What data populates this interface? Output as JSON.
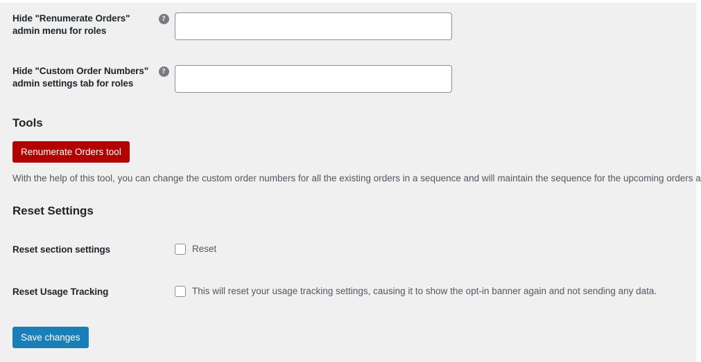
{
  "fields": [
    {
      "label": "Hide \"Renumerate Orders\" admin menu for roles",
      "help_icon": "question-mark-circle-icon",
      "value": "",
      "placeholder": ""
    },
    {
      "label": "Hide \"Custom Order Numbers\" admin settings tab for roles",
      "help_icon": "question-mark-circle-icon",
      "value": "",
      "placeholder": ""
    }
  ],
  "tools": {
    "heading": "Tools",
    "button_label": "Renumerate Orders tool",
    "button_color": "#b30000",
    "description": "With the help of this tool, you can change the custom order numbers for all the existing orders in a sequence and will maintain the sequence for the upcoming orders also."
  },
  "reset": {
    "heading": "Reset Settings",
    "rows": [
      {
        "label": "Reset section settings",
        "checkbox_text": "Reset",
        "checked": false
      },
      {
        "label": "Reset Usage Tracking",
        "checkbox_text": "This will reset your usage tracking settings, causing it to show the opt-in banner again and not sending any data.",
        "checked": false
      }
    ]
  },
  "footer": {
    "save_label": "Save changes",
    "save_color": "#1a7fb8"
  }
}
